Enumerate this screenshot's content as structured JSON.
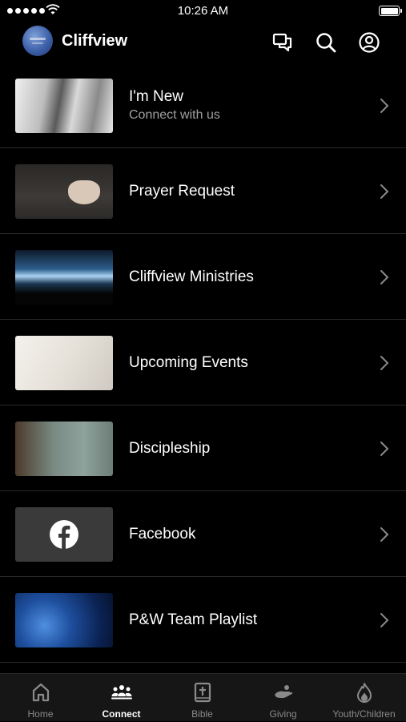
{
  "status_bar": {
    "time": "10:26 AM"
  },
  "header": {
    "title": "Cliffview",
    "icons": [
      "chat-icon",
      "search-icon",
      "account-icon"
    ]
  },
  "menu": {
    "items": [
      {
        "title": "I'm New",
        "subtitle": "Connect with us",
        "thumb": "hands-photo"
      },
      {
        "title": "Prayer Request",
        "thumb": "praying-hands-photo"
      },
      {
        "title": "Cliffview Ministries",
        "thumb": "concert-crowd-photo"
      },
      {
        "title": "Upcoming Events",
        "thumb": "notebook-photo"
      },
      {
        "title": "Discipleship",
        "thumb": "lake-photo"
      },
      {
        "title": "Facebook",
        "thumb": "facebook-icon"
      },
      {
        "title": "P&W Team Playlist",
        "thumb": "stage-microphone-photo"
      }
    ]
  },
  "tabs": [
    {
      "label": "Home",
      "icon": "home-icon"
    },
    {
      "label": "Connect",
      "icon": "people-icon",
      "active": true
    },
    {
      "label": "Bible",
      "icon": "bible-icon"
    },
    {
      "label": "Giving",
      "icon": "giving-icon"
    },
    {
      "label": "Youth/Children",
      "icon": "flame-icon"
    }
  ],
  "colors": {
    "background": "#000000",
    "tab_bar": "#161616",
    "divider": "#2a2a2a",
    "inactive": "#8a8a8a"
  }
}
